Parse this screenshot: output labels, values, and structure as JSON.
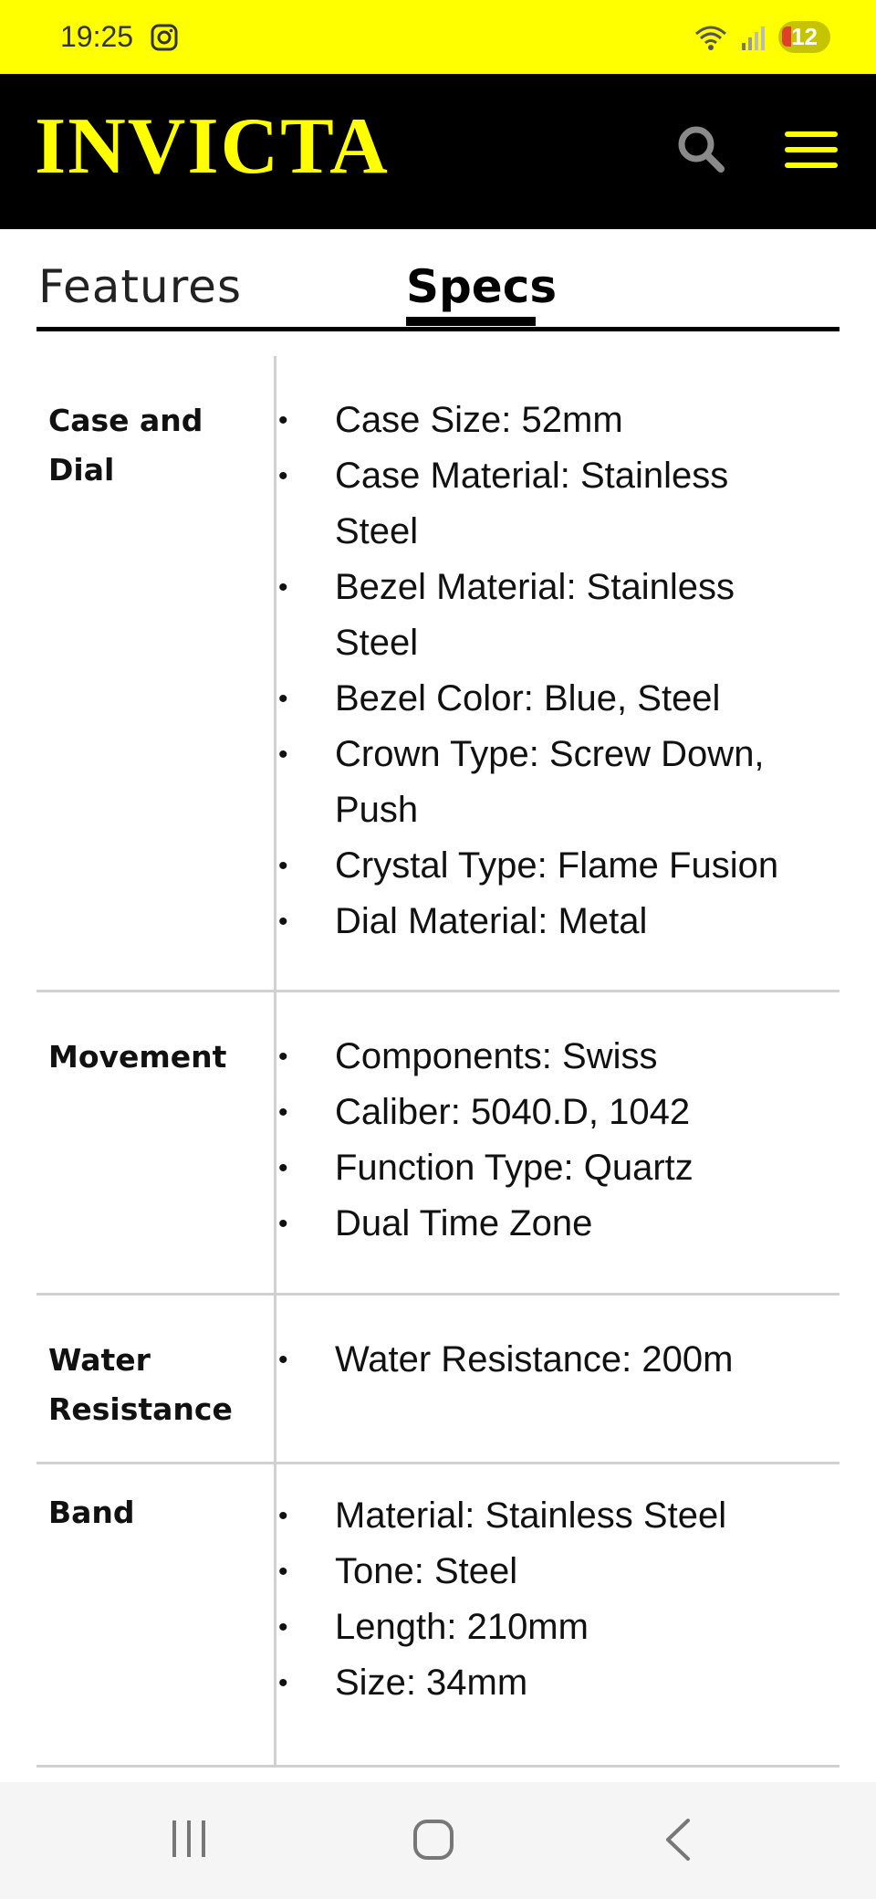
{
  "status_bar": {
    "time": "19:25",
    "battery": "12",
    "bg_color": "#ffff00"
  },
  "header": {
    "logo": "INVICTA",
    "logo_color": "#ffff00",
    "bg_color": "#000000"
  },
  "tabs": [
    {
      "label": "Features",
      "active": false
    },
    {
      "label": "Specs",
      "active": true
    }
  ],
  "specs": [
    {
      "label": "Case and Dial",
      "values": [
        "Case Size: 52mm",
        "Case Material: Stainless Steel",
        "Bezel Material: Stainless Steel",
        "Bezel Color: Blue, Steel",
        "Crown Type: Screw Down, Push",
        "Crystal Type: Flame Fusion",
        "Dial Material: Metal"
      ]
    },
    {
      "label": "Movement",
      "values": [
        "Components: Swiss",
        "Caliber: 5040.D, 1042",
        "Function Type: Quartz",
        "Dual Time Zone"
      ]
    },
    {
      "label": "Water Resistance",
      "values": [
        "Water Resistance: 200m"
      ]
    },
    {
      "label": "Band",
      "values": [
        "Material: Stainless Steel",
        "Tone: Steel",
        "Length: 210mm",
        "Size: 34mm"
      ]
    }
  ],
  "icons": {
    "status": [
      "instagram-icon",
      "wifi-icon",
      "signal-icon",
      "battery-icon"
    ],
    "header": [
      "search-icon",
      "hamburger-menu-icon"
    ],
    "nav": [
      "recent-apps-icon",
      "home-icon",
      "back-icon"
    ]
  }
}
